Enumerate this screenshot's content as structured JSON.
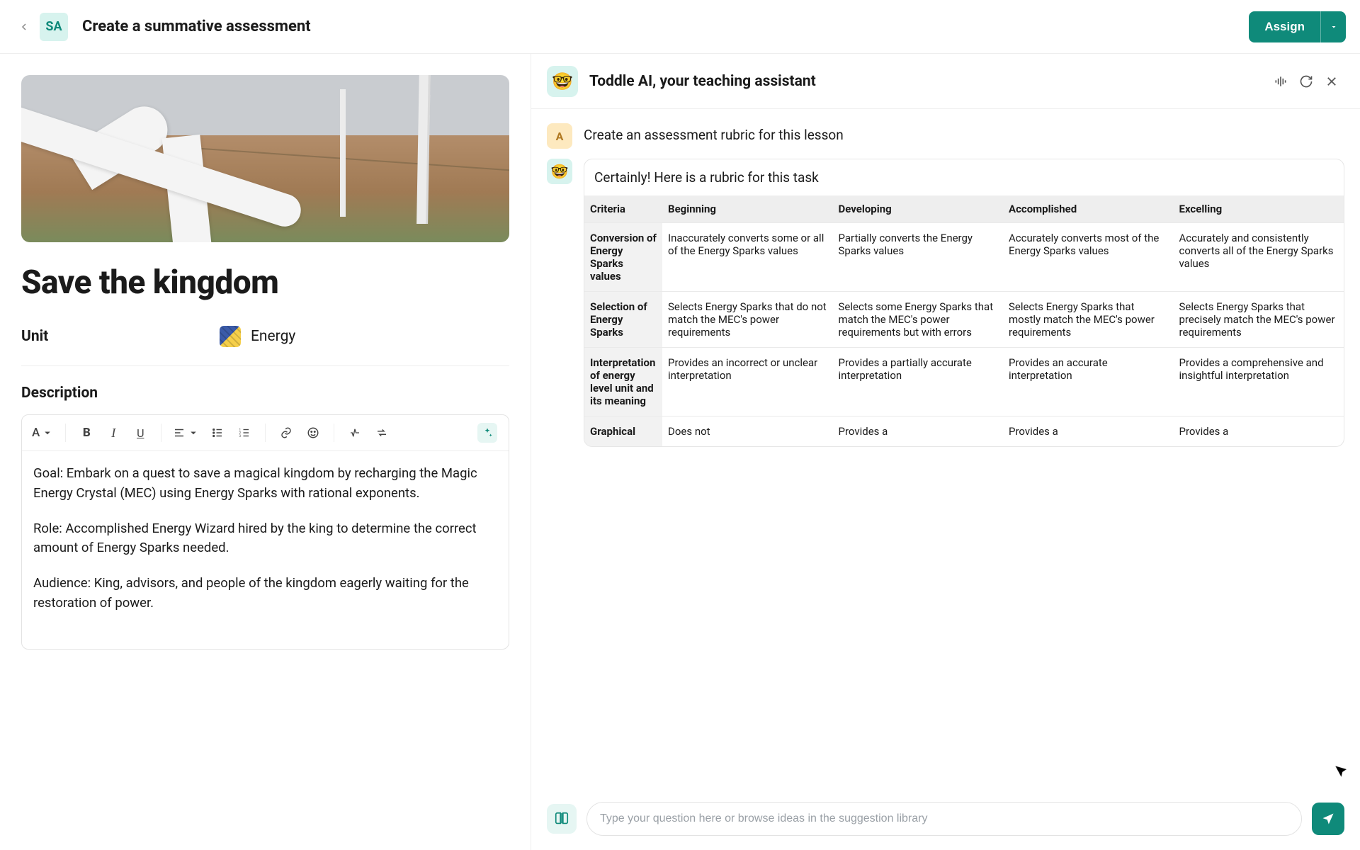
{
  "header": {
    "badge": "SA",
    "title": "Create a summative assessment",
    "assign_label": "Assign"
  },
  "doc": {
    "title": "Save the kingdom",
    "unit_label": "Unit",
    "unit_name": "Energy",
    "description_label": "Description",
    "body": {
      "p1": "Goal: Embark on a quest to save a magical kingdom by recharging the Magic Energy Crystal (MEC) using Energy Sparks with rational exponents.",
      "p2": "Role: Accomplished Energy Wizard hired by the king to determine the correct amount of Energy Sparks needed.",
      "p3": "Audience: King, advisors, and people of the kingdom eagerly waiting for the restoration of power."
    }
  },
  "ai": {
    "title": "Toddle AI, your teaching assistant",
    "avatar_emoji": "🤓",
    "user_initial": "A",
    "user_prompt": "Create an assessment rubric for this lesson",
    "bubble_intro": "Certainly! Here is a rubric for this task",
    "rubric": {
      "headers": [
        "Criteria",
        "Beginning",
        "Developing",
        "Accomplished",
        "Excelling"
      ],
      "rows": [
        {
          "criteria": "Conversion of Energy Sparks values",
          "cells": [
            "Inaccurately converts some or all of the Energy Sparks values",
            "Partially converts the Energy Sparks values",
            "Accurately converts most of the Energy Sparks values",
            "Accurately and consistently converts all of the Energy Sparks values"
          ]
        },
        {
          "criteria": "Selection of Energy Sparks",
          "cells": [
            "Selects Energy Sparks that do not match the MEC's power requirements",
            "Selects some Energy Sparks that match the MEC's power requirements but with errors",
            "Selects Energy Sparks that mostly match the MEC's power requirements",
            "Selects Energy Sparks that precisely match the MEC's power requirements"
          ]
        },
        {
          "criteria": "Interpretation of energy level unit and its meaning",
          "cells": [
            "Provides an incorrect or unclear interpretation",
            "Provides a partially accurate interpretation",
            "Provides an accurate interpretation",
            "Provides a comprehensive and insightful interpretation"
          ]
        },
        {
          "criteria": "Graphical",
          "cells": [
            "Does not",
            "Provides a",
            "Provides a",
            "Provides a"
          ]
        }
      ]
    },
    "input_placeholder": "Type your question here or browse ideas in the suggestion library"
  }
}
